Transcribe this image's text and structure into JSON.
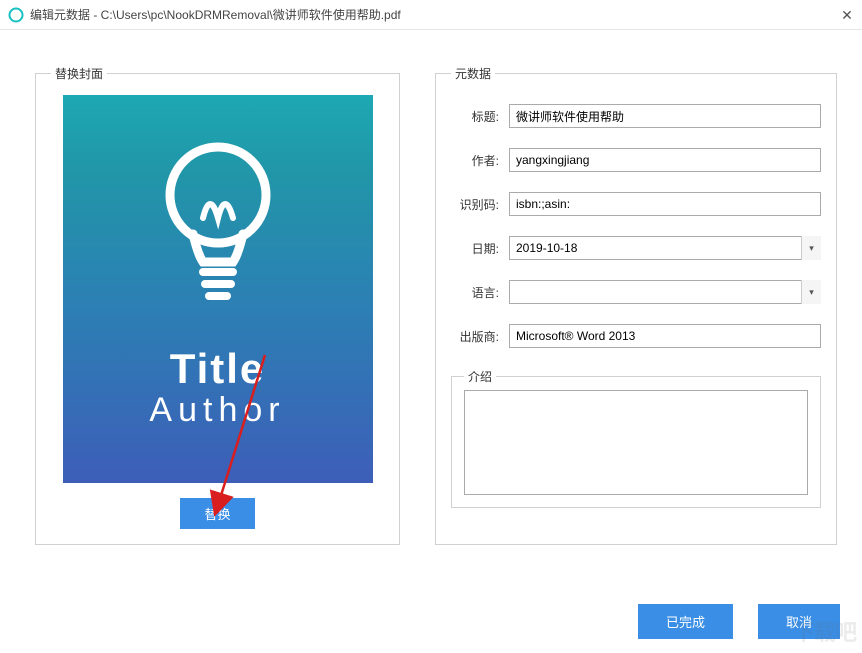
{
  "window": {
    "title": "编辑元数据 - C:\\Users\\pc\\NookDRMRemoval\\微讲师软件使用帮助.pdf",
    "close_glyph": "✕"
  },
  "cover": {
    "group_label": "替换封面",
    "mock_title": "Title",
    "mock_author": "Author",
    "replace_btn": "替换"
  },
  "meta": {
    "group_label": "元数据",
    "fields": {
      "title_label": "标题:",
      "title_value": "微讲师软件使用帮助",
      "author_label": "作者:",
      "author_value": "yangxingjiang",
      "id_label": "识别码:",
      "id_value": "isbn:;asin:",
      "date_label": "日期:",
      "date_value": "2019-10-18",
      "lang_label": "语言:",
      "lang_value": "",
      "publisher_label": "出版商:",
      "publisher_value": "Microsoft® Word 2013"
    },
    "intro_label": "介绍",
    "intro_value": ""
  },
  "footer": {
    "done": "已完成",
    "cancel": "取消"
  },
  "watermark_text": "下载吧"
}
